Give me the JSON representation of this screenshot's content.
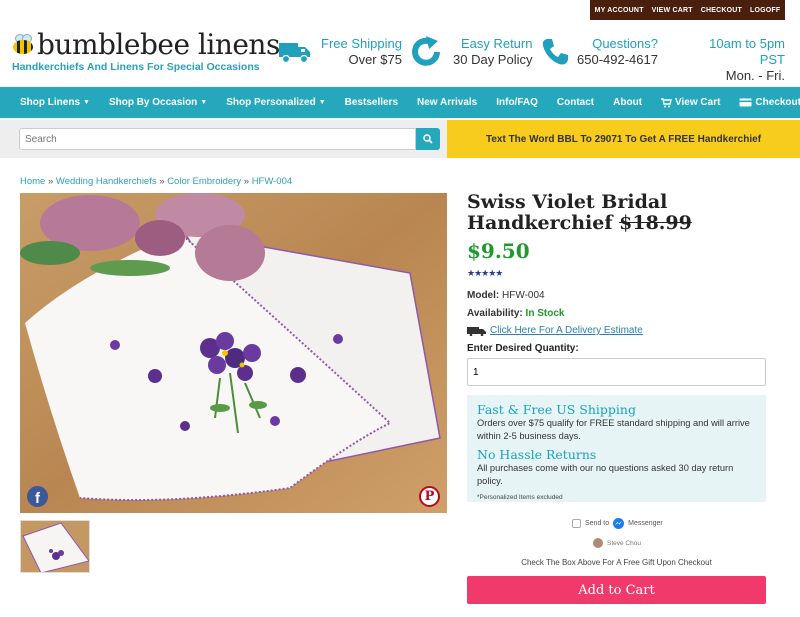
{
  "account_bar": {
    "items": [
      "MY ACCOUNT",
      "VIEW CART",
      "CHECKOUT",
      "LOGOFF"
    ]
  },
  "header": {
    "logo_text": "bumblebee linens",
    "tagline": "Handkerchiefs And Linens For Special Occasions",
    "shipping": {
      "line1": "Free Shipping",
      "line2": "Over $75",
      "icon": "truck-icon"
    },
    "returns": {
      "line1": "Easy Return",
      "line2": "30 Day Policy",
      "icon": "return-arrow-icon"
    },
    "questions": {
      "line1": "Questions?",
      "line2": "650-492-4617",
      "icon": "phone-icon"
    },
    "hours": {
      "line1": "10am to 5pm PST",
      "line2": "Mon. - Fri."
    }
  },
  "nav": {
    "items": [
      {
        "label": "Shop Linens",
        "dropdown": true
      },
      {
        "label": "Shop By Occasion",
        "dropdown": true
      },
      {
        "label": "Shop Personalized",
        "dropdown": true
      },
      {
        "label": "Bestsellers",
        "dropdown": false
      },
      {
        "label": "New Arrivals",
        "dropdown": false
      },
      {
        "label": "Info/FAQ",
        "dropdown": false
      },
      {
        "label": "Contact",
        "dropdown": false
      },
      {
        "label": "About",
        "dropdown": false
      },
      {
        "label": "View Cart",
        "icon": "cart-icon"
      },
      {
        "label": "Checkout",
        "icon": "credit-card-icon"
      }
    ]
  },
  "search": {
    "placeholder": "Search",
    "value": ""
  },
  "promo": {
    "text": "Text The Word BBL To 29071 To Get A FREE Handkerchief"
  },
  "breadcrumb": {
    "items": [
      "Home",
      "Wedding Handkerchiefs",
      "Color Embroidery",
      "HFW-004"
    ],
    "separator": "»"
  },
  "product": {
    "title_line1": "Swiss Violet Bridal",
    "title_line2": "Handkerchief",
    "old_price": "$18.99",
    "price": "$9.50",
    "stars": "★★★★★",
    "model_label": "Model:",
    "model_value": "HFW-004",
    "availability_label": "Availability:",
    "availability_value": "In Stock",
    "delivery_link": "Click Here For A Delivery Estimate",
    "qty_label": "Enter Desired Quantity:",
    "qty_value": "1"
  },
  "shipping_box": {
    "heading1": "Fast & Free US Shipping",
    "text1": "Orders over $75 qualify for FREE standard shipping and will arrive within 2-5 business days.",
    "heading2": "No Hassle Returns",
    "text2": "All purchases come with our no questions asked 30 day return policy.",
    "note": "*Personalized Items excluded"
  },
  "messenger": {
    "send_to": "Send to",
    "app": "Messenger",
    "user": "Steve Chou"
  },
  "gift_note": "Check The Box Above For A Free Gift Upon Checkout",
  "add_to_cart": "Add to Cart",
  "colors": {
    "accent": "#26a8bc",
    "price": "#1e9a2b",
    "cta": "#f03a6b",
    "promo": "#f8cc1d",
    "account_bar": "#4a1f0e"
  }
}
